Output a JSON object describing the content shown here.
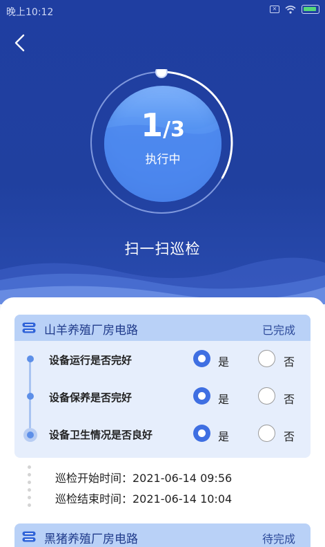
{
  "status_bar": {
    "time": "晚上10:12"
  },
  "progress": {
    "current": "1",
    "slash": "/",
    "total": "3",
    "status": "执行中",
    "fraction": 0.333
  },
  "scan_title": "扫一扫巡检",
  "tasks": [
    {
      "name": "山羊养殖厂房电路",
      "status": "已完成",
      "checks": [
        {
          "question": "设备运行是否完好",
          "yes": "是",
          "no": "否",
          "selected": "yes"
        },
        {
          "question": "设备保养是否完好",
          "yes": "是",
          "no": "否",
          "selected": "yes"
        },
        {
          "question": "设备卫生情况是否良好",
          "yes": "是",
          "no": "否",
          "selected": "yes"
        }
      ],
      "start_time": "巡检开始时间：2021-06-14 09:56",
      "end_time": "巡检结束时间：2021-06-14 10:04"
    },
    {
      "name": "黑猪养殖厂房电路",
      "status": "待完成"
    }
  ],
  "icons": {
    "back": "chevron-left-icon",
    "task": "server-icon"
  },
  "colors": {
    "header_bg": "#20409f",
    "accent": "#3f6fe2",
    "task_head": "#b9d1f7"
  }
}
